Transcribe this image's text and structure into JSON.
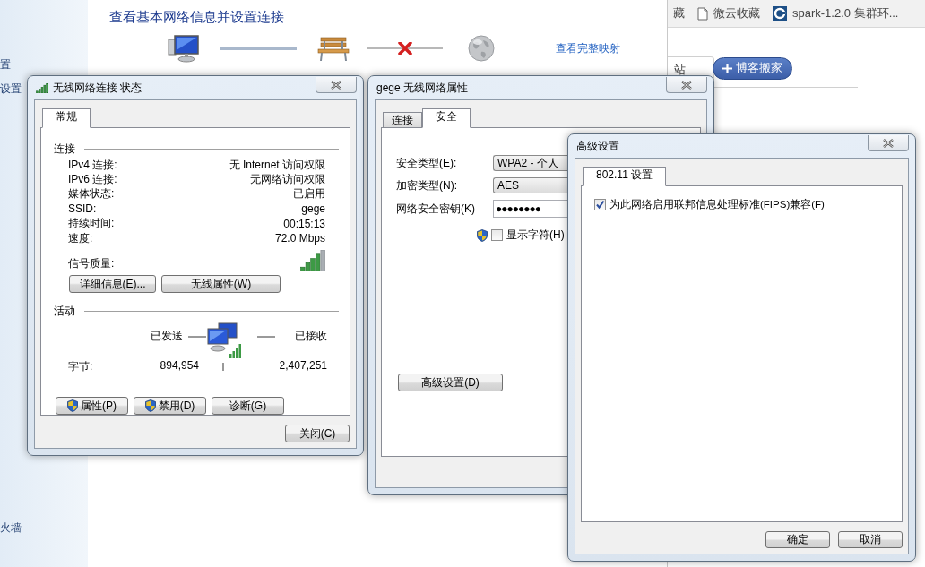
{
  "sidebar": {
    "items": [
      "置",
      "设置",
      "火墙"
    ]
  },
  "control_panel": {
    "title": "查看基本网络信息并设置连接",
    "map_link": "查看完整映射"
  },
  "browser": {
    "bookmarks": [
      "藏",
      "微云收藏",
      "spark-1.2.0 集群环..."
    ],
    "tab_label": "站",
    "move_button": "博客搬家"
  },
  "status_dialog": {
    "title": "无线网络连接 状态",
    "tabs": [
      {
        "label": "常规",
        "selected": true
      }
    ],
    "connection_heading": "连接",
    "rows": [
      {
        "label": "IPv4 连接:",
        "value": "无 Internet 访问权限"
      },
      {
        "label": "IPv6 连接:",
        "value": "无网络访问权限"
      },
      {
        "label": "媒体状态:",
        "value": "已启用"
      },
      {
        "label": "SSID:",
        "value": "gege"
      },
      {
        "label": "持续时间:",
        "value": "00:15:13"
      },
      {
        "label": "速度:",
        "value": "72.0 Mbps"
      }
    ],
    "signal_label": "信号质量:",
    "buttons": [
      "详细信息(E)...",
      "无线属性(W)"
    ],
    "activity_heading": "活动",
    "sent_label": "已发送",
    "received_label": "已接收",
    "bytes_label": "字节:",
    "bytes_sent": "894,954",
    "bytes_received": "2,407,251",
    "action_buttons": [
      {
        "label": "属性(P)",
        "shield": true
      },
      {
        "label": "禁用(D)",
        "shield": true
      },
      {
        "label": "诊断(G)",
        "shield": false
      }
    ],
    "close_button": "关闭(C)"
  },
  "properties_dialog": {
    "title": "gege 无线网络属性",
    "tabs": [
      {
        "label": "连接",
        "selected": false
      },
      {
        "label": "安全",
        "selected": true
      }
    ],
    "fields": [
      {
        "label": "安全类型(E):",
        "value": "WPA2 - 个人",
        "kind": "dropdown"
      },
      {
        "label": "加密类型(N):",
        "value": "AES",
        "kind": "dropdown"
      },
      {
        "label": "网络安全密钥(K)",
        "value": "●●●●●●●●",
        "kind": "password"
      }
    ],
    "show_chars": {
      "label": "显示字符(H)",
      "checked": false
    },
    "advanced_button": "高级设置(D)"
  },
  "advanced_dialog": {
    "title": "高级设置",
    "tabs": [
      {
        "label": "802.11 设置",
        "selected": true
      }
    ],
    "fips": {
      "label": "为此网络启用联邦信息处理标准(FIPS)兼容(F)",
      "checked": true
    },
    "buttons": [
      "确定",
      "取消"
    ]
  }
}
